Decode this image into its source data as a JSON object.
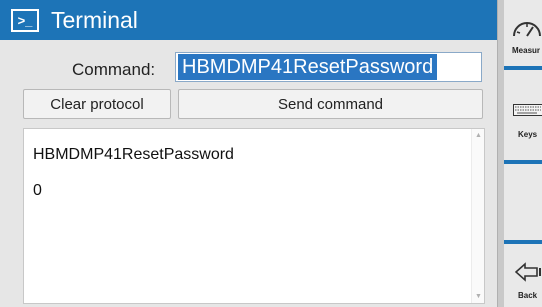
{
  "title_bar": {
    "title": "Terminal",
    "icon": "terminal-icon",
    "icon_glyph": ">_",
    "color": "#1d74b7"
  },
  "command": {
    "label": "Command:",
    "value": "HBMDMP41ResetPassword"
  },
  "buttons": {
    "clear_label": "Clear protocol",
    "send_label": "Send command"
  },
  "protocol": {
    "lines": [
      "HBMDMP41ResetPassword",
      "0"
    ]
  },
  "nav": {
    "items": [
      {
        "label": "Measur",
        "icon": "gauge-icon"
      },
      {
        "label": "Keys",
        "icon": "keyboard-icon"
      },
      {
        "label": "",
        "icon": ""
      },
      {
        "label": "Back",
        "icon": "back-arrow-icon"
      }
    ]
  }
}
